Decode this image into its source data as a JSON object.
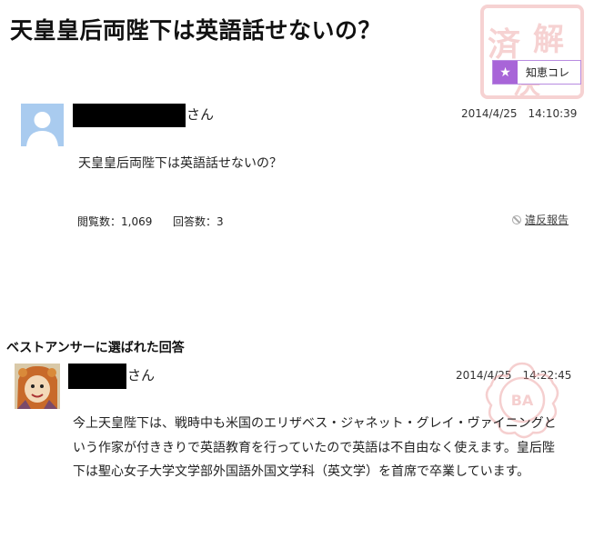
{
  "question": {
    "title": "天皇皇后両陛下は英語話せないの？",
    "user_suffix": "さん",
    "timestamp": "2014/4/25　14:10:39",
    "body": "天皇皇后両陛下は英語話せないの？",
    "views_label": "閲覧数：",
    "views_value": "1,069",
    "answers_label": "回答数：",
    "answers_value": "3",
    "report_label": "違反報告"
  },
  "chie_button": {
    "label": "知恵コレ",
    "icon": "star-icon"
  },
  "stamp_resolved": {
    "text": "済解決",
    "icon": "resolved-stamp"
  },
  "best_answer": {
    "heading": "ベストアンサーに選ばれた回答",
    "user_suffix": "さん",
    "timestamp": "2014/4/25　14:22:45",
    "body": "今上天皇陛下は、戦時中も米国のエリザベス・ジャネット・グレイ・ヴァイニングという作家が付ききりで英語教育を行っていたので英語は不自由なく使えます。皇后陛下は聖心女子大学文学部外国語外国文学科（英文学）を首席で卒業しています。",
    "badge_icon": "best-answer-stamp"
  },
  "colors": {
    "accent": "#a865d8",
    "stamp": "#e88a8a",
    "avatar_default": "#a9cbef"
  }
}
